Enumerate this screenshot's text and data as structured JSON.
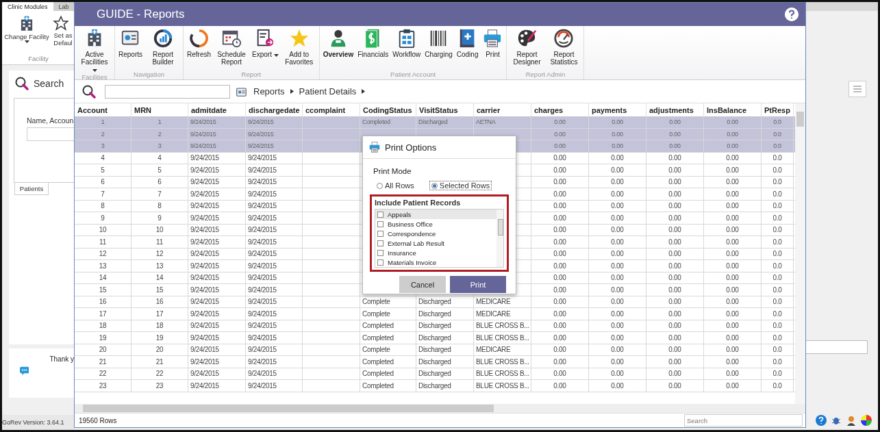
{
  "background_app": {
    "tabs": [
      {
        "label": "Clinic Modules",
        "selected": true
      },
      {
        "label": "Lab",
        "selected": false
      }
    ],
    "ribbon_buttons": [
      {
        "label": "Change Facility",
        "dropdown": true
      },
      {
        "label": "Set as Defaul",
        "dropdown": false
      }
    ],
    "ribbon_group": "Facility",
    "search_title": "Search",
    "search_label": "Name, Accoun",
    "side_tab": "Patients",
    "message": "Thank y",
    "version": "GoRev Version: 3.64.1"
  },
  "window": {
    "title": "GUIDE - Reports",
    "ribbon_groups": [
      {
        "label": "Facilities",
        "items": [
          {
            "label": "Active Facilities",
            "dropdown": true,
            "selected": false
          }
        ]
      },
      {
        "label": "Navigation",
        "items": [
          {
            "label": "Reports",
            "dropdown": false,
            "selected": false
          },
          {
            "label": "Report Builder",
            "dropdown": false,
            "selected": false
          }
        ]
      },
      {
        "label": "Report",
        "items": [
          {
            "label": "Refresh",
            "dropdown": false,
            "selected": false
          },
          {
            "label": "Schedule Report",
            "dropdown": false,
            "selected": false
          },
          {
            "label": "Export",
            "dropdown": true,
            "selected": false
          },
          {
            "label": "Add to Favorites",
            "dropdown": false,
            "selected": false
          }
        ]
      },
      {
        "label": "Patient Account",
        "items": [
          {
            "label": "Overview",
            "dropdown": false,
            "selected": true
          },
          {
            "label": "Financials",
            "dropdown": false,
            "selected": false
          },
          {
            "label": "Workflow",
            "dropdown": false,
            "selected": false
          },
          {
            "label": "Charging",
            "dropdown": false,
            "selected": false
          },
          {
            "label": "Coding",
            "dropdown": false,
            "selected": false
          },
          {
            "label": "Print",
            "dropdown": false,
            "selected": false
          }
        ]
      },
      {
        "label": "Report Admin",
        "items": [
          {
            "label": "Report Designer",
            "dropdown": false,
            "selected": false
          },
          {
            "label": "Report Statistics",
            "dropdown": false,
            "selected": false
          }
        ]
      }
    ],
    "breadcrumb": [
      "Reports",
      "Patient Details"
    ],
    "table": {
      "columns": [
        "Account",
        "MRN",
        "admitdate",
        "dischargedate",
        "ccomplaint",
        "CodingStatus",
        "VisitStatus",
        "carrier",
        "charges",
        "payments",
        "adjustments",
        "InsBalance",
        "PtResp"
      ],
      "rows": [
        {
          "selected": true,
          "cells": [
            "1",
            "1",
            "9/24/2015",
            "9/24/2015",
            null,
            "Completed",
            "Discharged",
            "AETNA",
            "0.00",
            "0.00",
            "0.00",
            "0.00",
            "0.0"
          ]
        },
        {
          "selected": true,
          "cells": [
            "2",
            "2",
            "9/24/2015",
            "9/24/2015",
            null,
            null,
            null,
            null,
            "0.00",
            "0.00",
            "0.00",
            "0.00",
            "0.0"
          ]
        },
        {
          "selected": true,
          "cells": [
            "3",
            "3",
            "9/24/2015",
            "9/24/2015",
            null,
            null,
            null,
            null,
            "0.00",
            "0.00",
            "0.00",
            "0.00",
            "0.0"
          ]
        },
        {
          "selected": false,
          "cells": [
            "4",
            "4",
            "9/24/2015",
            "9/24/2015",
            null,
            null,
            null,
            null,
            "0.00",
            "0.00",
            "0.00",
            "0.00",
            "0.0"
          ]
        },
        {
          "selected": false,
          "cells": [
            "5",
            "5",
            "9/24/2015",
            "9/24/2015",
            null,
            null,
            null,
            null,
            "0.00",
            "0.00",
            "0.00",
            "0.00",
            "0.0"
          ]
        },
        {
          "selected": false,
          "cells": [
            "6",
            "6",
            "9/24/2015",
            "9/24/2015",
            null,
            null,
            null,
            null,
            "0.00",
            "0.00",
            "0.00",
            "0.00",
            "0.0"
          ]
        },
        {
          "selected": false,
          "cells": [
            "7",
            "7",
            "9/24/2015",
            "9/24/2015",
            null,
            null,
            null,
            null,
            "0.00",
            "0.00",
            "0.00",
            "0.00",
            "0.0"
          ]
        },
        {
          "selected": false,
          "cells": [
            "8",
            "8",
            "9/24/2015",
            "9/24/2015",
            null,
            null,
            null,
            null,
            "0.00",
            "0.00",
            "0.00",
            "0.00",
            "0.0"
          ]
        },
        {
          "selected": false,
          "cells": [
            "9",
            "9",
            "9/24/2015",
            "9/24/2015",
            null,
            null,
            null,
            null,
            "0.00",
            "0.00",
            "0.00",
            "0.00",
            "0.0"
          ]
        },
        {
          "selected": false,
          "cells": [
            "10",
            "10",
            "9/24/2015",
            "9/24/2015",
            null,
            null,
            null,
            null,
            "0.00",
            "0.00",
            "0.00",
            "0.00",
            "0.0"
          ]
        },
        {
          "selected": false,
          "cells": [
            "11",
            "11",
            "9/24/2015",
            "9/24/2015",
            null,
            null,
            null,
            null,
            "0.00",
            "0.00",
            "0.00",
            "0.00",
            "0.0"
          ]
        },
        {
          "selected": false,
          "cells": [
            "12",
            "12",
            "9/24/2015",
            "9/24/2015",
            null,
            null,
            null,
            null,
            "0.00",
            "0.00",
            "0.00",
            "0.00",
            "0.0"
          ]
        },
        {
          "selected": false,
          "cells": [
            "13",
            "13",
            "9/24/2015",
            "9/24/2015",
            null,
            null,
            null,
            null,
            "0.00",
            "0.00",
            "0.00",
            "0.00",
            "0.0"
          ]
        },
        {
          "selected": false,
          "cells": [
            "14",
            "14",
            "9/24/2015",
            "9/24/2015",
            null,
            null,
            null,
            null,
            "0.00",
            "0.00",
            "0.00",
            "0.00",
            "0.0"
          ]
        },
        {
          "selected": false,
          "cells": [
            "15",
            "15",
            "9/24/2015",
            "9/24/2015",
            null,
            null,
            null,
            null,
            "0.00",
            "0.00",
            "0.00",
            "0.00",
            "0.0"
          ]
        },
        {
          "selected": false,
          "cells": [
            "16",
            "16",
            "9/24/2015",
            "9/24/2015",
            null,
            "Complete",
            "Discharged",
            "MEDICARE",
            "0.00",
            "0.00",
            "0.00",
            "0.00",
            "0.0"
          ]
        },
        {
          "selected": false,
          "cells": [
            "17",
            "17",
            "9/24/2015",
            "9/24/2015",
            null,
            "Complete",
            "Discharged",
            "MEDICARE",
            "0.00",
            "0.00",
            "0.00",
            "0.00",
            "0.0"
          ]
        },
        {
          "selected": false,
          "cells": [
            "18",
            "18",
            "9/24/2015",
            "9/24/2015",
            null,
            "Completed",
            "Discharged",
            "BLUE CROSS B...",
            "0.00",
            "0.00",
            "0.00",
            "0.00",
            "0.0"
          ]
        },
        {
          "selected": false,
          "cells": [
            "19",
            "19",
            "9/24/2015",
            "9/24/2015",
            null,
            "Completed",
            "Discharged",
            "BLUE CROSS B...",
            "0.00",
            "0.00",
            "0.00",
            "0.00",
            "0.0"
          ]
        },
        {
          "selected": false,
          "cells": [
            "20",
            "20",
            "9/24/2015",
            "9/24/2015",
            null,
            "Complete",
            "Discharged",
            "MEDICARE",
            "0.00",
            "0.00",
            "0.00",
            "0.00",
            "0.0"
          ]
        },
        {
          "selected": false,
          "cells": [
            "21",
            "21",
            "9/24/2015",
            "9/24/2015",
            null,
            "Completed",
            "Discharged",
            "BLUE CROSS B...",
            "0.00",
            "0.00",
            "0.00",
            "0.00",
            "0.0"
          ]
        },
        {
          "selected": false,
          "cells": [
            "22",
            "22",
            "9/24/2015",
            "9/24/2015",
            null,
            "Completed",
            "Discharged",
            "BLUE CROSS B...",
            "0.00",
            "0.00",
            "0.00",
            "0.00",
            "0.0"
          ]
        },
        {
          "selected": false,
          "cells": [
            "23",
            "23",
            "9/24/2015",
            "9/24/2015",
            null,
            "Completed",
            "Discharged",
            "BLUE CROSS B...",
            "0.00",
            "0.00",
            "0.00",
            "0.00",
            "0.0"
          ]
        }
      ]
    },
    "status_bar": {
      "row_count": "19560 Rows",
      "search_placeholder": "Search"
    }
  },
  "dialog": {
    "title": "Print Options",
    "mode_label": "Print Mode",
    "modes": [
      {
        "label": "All Rows",
        "selected": false
      },
      {
        "label": "Selected Rows",
        "selected": true
      }
    ],
    "records_label": "Include Patient Records",
    "records": [
      {
        "label": "Appeals",
        "checked": false,
        "selected": true
      },
      {
        "label": "Business Office",
        "checked": false,
        "selected": false
      },
      {
        "label": "Correspondence",
        "checked": false,
        "selected": false
      },
      {
        "label": "External Lab Result",
        "checked": false,
        "selected": false
      },
      {
        "label": "Insurance",
        "checked": false,
        "selected": false
      },
      {
        "label": "Materials Invoice",
        "checked": false,
        "selected": false
      }
    ],
    "buttons": [
      "Cancel",
      "Print"
    ]
  }
}
